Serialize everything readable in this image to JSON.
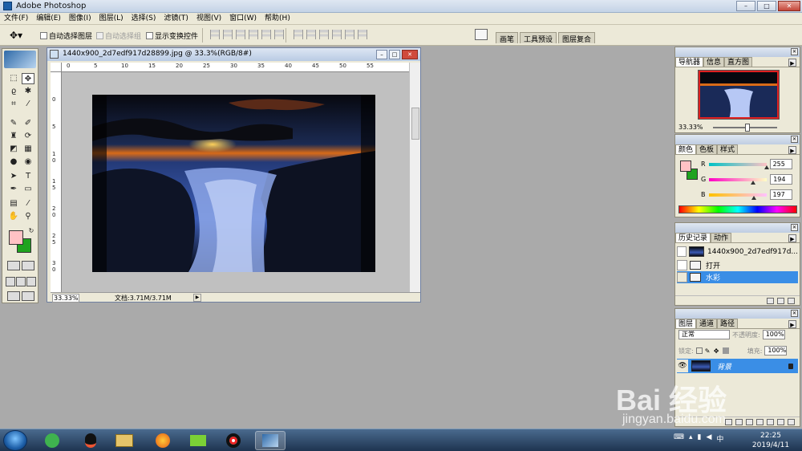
{
  "window": {
    "title": "Adobe Photoshop",
    "minimize": "–",
    "maximize": "□",
    "close": "✕"
  },
  "menu": [
    "文件(F)",
    "编辑(E)",
    "图像(I)",
    "图层(L)",
    "选择(S)",
    "滤镜(T)",
    "视图(V)",
    "窗口(W)",
    "帮助(H)"
  ],
  "options": {
    "auto_select_layer": "自动选择图层",
    "auto_select_group": "自动选择组",
    "show_transform": "显示变换控件",
    "well_tabs": [
      "画笔",
      "工具预设",
      "图层复合"
    ]
  },
  "document": {
    "title": "1440x900_2d7edf917d28899.jpg @ 33.3%(RGB/8#)",
    "ruler_h": [
      "0",
      "5",
      "10",
      "15",
      "20",
      "25",
      "30",
      "35",
      "40",
      "45",
      "50",
      "55"
    ],
    "ruler_v": [
      "0",
      "5",
      "1 0",
      "1 5",
      "2 0",
      "2 5",
      "3 0"
    ],
    "zoom": "33.33%",
    "doc_size": "文档:3.71M/3.71M"
  },
  "navigator": {
    "tabs": [
      "导航器",
      "信息",
      "直方图"
    ],
    "zoom": "33.33%"
  },
  "color": {
    "tabs": [
      "颜色",
      "色板",
      "样式"
    ],
    "channels": [
      {
        "label": "R",
        "value": "255",
        "pos": 1.0
      },
      {
        "label": "G",
        "value": "194",
        "pos": 0.76
      },
      {
        "label": "B",
        "value": "197",
        "pos": 0.77
      }
    ],
    "foreground": "#ffc2c5",
    "background": "#1fa31f"
  },
  "history": {
    "tabs": [
      "历史记录",
      "动作"
    ],
    "snapshot": "1440x900_2d7edf917d...",
    "items": [
      "打开",
      "水彩"
    ],
    "selected": "水彩"
  },
  "layers": {
    "tabs": [
      "图层",
      "通道",
      "路径"
    ],
    "blend_mode": "正常",
    "opacity_label": "不透明度:",
    "opacity": "100%",
    "lock_label": "锁定:",
    "fill_label": "填充:",
    "fill": "100%",
    "layer_name": "背景"
  },
  "taskbar": {
    "time": "22:25",
    "date": "2019/4/11"
  },
  "watermark": {
    "brand": "Bai 经验",
    "url": "jingyan.baidu.com"
  },
  "accent": "#3a8ee6"
}
